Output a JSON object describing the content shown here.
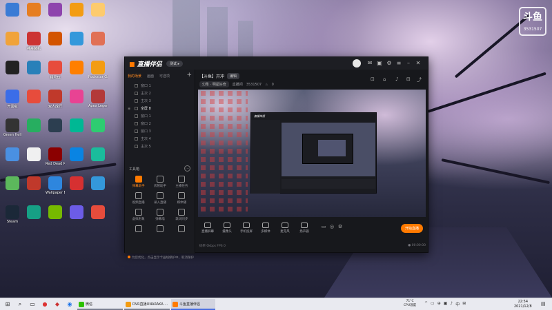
{
  "desktop": {
    "icons": [
      {
        "label": "",
        "color": "#3a7bd5"
      },
      {
        "label": "",
        "color": "#f1a33a"
      },
      {
        "label": "",
        "color": "#222222"
      },
      {
        "label": "开黑啦",
        "color": "#3b6de8"
      },
      {
        "label": "Green Hell",
        "color": "#333333"
      },
      {
        "label": "",
        "color": "#4a90e2"
      },
      {
        "label": "",
        "color": "#5cb85c"
      },
      {
        "label": "Steam",
        "color": "#1b2838"
      },
      {
        "label": "",
        "color": "#e67e22"
      },
      {
        "label": "神舟装机",
        "color": "#cc3333"
      },
      {
        "label": "",
        "color": "#2980b9"
      },
      {
        "label": "",
        "color": "#e74c3c"
      },
      {
        "label": "",
        "color": "#27ae60"
      },
      {
        "label": "",
        "color": "#f0f0f0"
      },
      {
        "label": "",
        "color": "#c0392b"
      },
      {
        "label": "",
        "color": "#16a085"
      },
      {
        "label": "",
        "color": "#8e44ad"
      },
      {
        "label": "",
        "color": "#d35400"
      },
      {
        "label": "租号玩",
        "color": "#e74c3c"
      },
      {
        "label": "双人成行",
        "color": "#c0392b"
      },
      {
        "label": "",
        "color": "#2c3e50"
      },
      {
        "label": "Red Dead Redemption",
        "color": "#8b0000"
      },
      {
        "label": "Wallpaper Engine",
        "color": "#2e86de"
      },
      {
        "label": "",
        "color": "#76b900"
      },
      {
        "label": "",
        "color": "#f39c12"
      },
      {
        "label": "",
        "color": "#3498db"
      },
      {
        "label": "",
        "color": "#ff7f00"
      },
      {
        "label": "",
        "color": "#e84393"
      },
      {
        "label": "",
        "color": "#00b894"
      },
      {
        "label": "",
        "color": "#0984e3"
      },
      {
        "label": "",
        "color": "#d63031"
      },
      {
        "label": "",
        "color": "#6c5ce7"
      },
      {
        "label": "",
        "color": "#fdcb6e"
      },
      {
        "label": "",
        "color": "#e17055"
      },
      {
        "label": "Rockstar Games",
        "color": "#f39c12"
      },
      {
        "label": "Apex Legends",
        "color": "#b33939"
      },
      {
        "label": "",
        "color": "#2ecc71"
      },
      {
        "label": "",
        "color": "#1abc9c"
      },
      {
        "label": "",
        "color": "#3498db"
      },
      {
        "label": "",
        "color": "#e74c3c"
      },
      {
        "label": "",
        "color": "#5b6cff"
      },
      {
        "label": "",
        "color": "#2d98da"
      },
      {
        "label": "",
        "color": "#eb3b5a"
      },
      {
        "label": "",
        "color": "#20bf6b"
      },
      {
        "label": "",
        "color": "#4b7bec"
      },
      {
        "label": "",
        "color": "#fd9644"
      },
      {
        "label": "",
        "color": "#a55eea"
      },
      {
        "label": "",
        "color": "#45aaf2"
      }
    ]
  },
  "watermark": {
    "logo": "斗鱼",
    "room_label": "3531507"
  },
  "app": {
    "logo_text": "直播伴侣",
    "version_badge": "测试 ▸",
    "tabs": [
      {
        "label": "我的场景",
        "active": true
      },
      {
        "label": "画面",
        "active": false
      },
      {
        "label": "可选项",
        "active": false
      }
    ],
    "add_label": "+",
    "scenes": [
      {
        "label": "窗口 1",
        "selected": false
      },
      {
        "label": "主次 2",
        "selected": false
      },
      {
        "label": "主次 3",
        "selected": false
      },
      {
        "label": "全屏 8",
        "selected": true
      },
      {
        "label": "窗口 1",
        "selected": false
      },
      {
        "label": "窗口 2",
        "selected": false
      },
      {
        "label": "窗口 3",
        "selected": false
      },
      {
        "label": "主次 4",
        "selected": false
      },
      {
        "label": "主次 5",
        "selected": false
      }
    ],
    "tools_title": "工具箱",
    "tools_more": "…",
    "tools": [
      {
        "label": "弹幕助手",
        "hot": true
      },
      {
        "label": "房管助手",
        "hot": false
      },
      {
        "label": "主播任务",
        "hot": false
      },
      {
        "label": "视频直播",
        "hot": false
      },
      {
        "label": "录入直播",
        "hot": false
      },
      {
        "label": "媒体播",
        "hot": false
      },
      {
        "label": "虚拟形象",
        "hot": false
      },
      {
        "label": "弹幕墙",
        "hot": false
      },
      {
        "label": "歌词同步",
        "hot": false
      },
      {
        "label": "",
        "hot": false
      },
      {
        "label": "",
        "hot": false
      },
      {
        "label": "",
        "hot": false
      }
    ],
    "stream": {
      "title": "【斗鱼】开冲",
      "edit_label": "编辑",
      "category": "幻隼 · 明星好奇",
      "room_label": "直播间",
      "room_id": "3531507",
      "heat": "0"
    },
    "controls": [
      {
        "label": "直播屏幕"
      },
      {
        "label": "摄像头"
      },
      {
        "label": "手机投屏"
      },
      {
        "label": "多媒体"
      },
      {
        "label": "麦克风"
      },
      {
        "label": "扬声器"
      }
    ],
    "go_live_label": "开始直播",
    "left_status": "为您优化，点击显示卡画线保护中，取消保护",
    "right_status_left": "码率 0kbps   FPS 0",
    "right_status_right": "● 00:00:00"
  },
  "taskbar": {
    "search_icon": "search-icon",
    "tasks": [
      {
        "label": "微信",
        "color": "#2dc100",
        "state": "open"
      },
      {
        "label": "DVR直播UNARAKA ...",
        "color": "#f39c12",
        "state": "open"
      },
      {
        "label": "斗鱼直播伴侣",
        "color": "#ff7a00",
        "state": "active"
      }
    ],
    "weather_temp": "71°C",
    "weather_label": "CPU温度",
    "tray_icons": [
      "^",
      "▭",
      "⊕",
      "▣",
      "♪",
      "中",
      "⊞"
    ],
    "clock_time": "22:54",
    "clock_date": "2021/12/8"
  }
}
